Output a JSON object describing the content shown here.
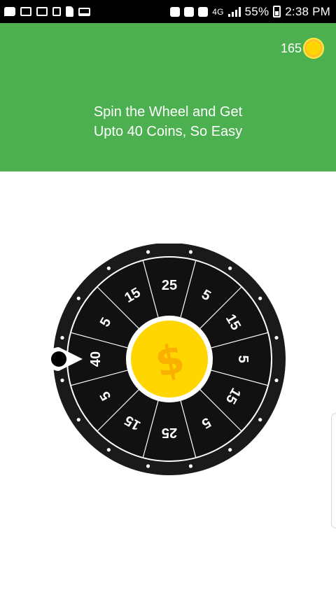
{
  "status_bar": {
    "left_icons": [
      "chat-icon",
      "mail-icon",
      "photo-icon",
      "usb-icon",
      "sim-card-icon",
      "laptop-icon"
    ],
    "right_icons": [
      "alarm-lock-icon",
      "mute-icon",
      "alarm-icon"
    ],
    "network": "4G",
    "battery": "55%",
    "time": "2:38 PM"
  },
  "header": {
    "coins": "165",
    "tagline_line1": "Spin the Wheel and Get",
    "tagline_line2": "Upto 40 Coins, So Easy"
  },
  "wheel": {
    "segments": [
      "40",
      "5",
      "15",
      "25",
      "5",
      "15",
      "5",
      "15",
      "5",
      "25",
      "15",
      "5"
    ],
    "center_symbol": "$",
    "colors": {
      "rim": "#1a1a1a",
      "segment": "#111111",
      "divider": "#ffffff",
      "coin": "#ffd600",
      "coin_symbol": "#f9b000",
      "header": "#4caf50"
    }
  }
}
